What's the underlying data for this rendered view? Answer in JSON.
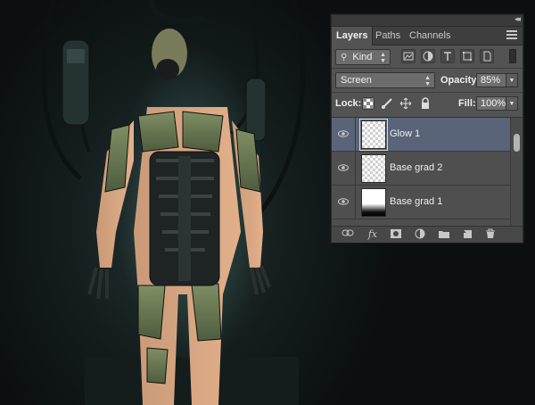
{
  "panel": {
    "tabs": [
      "Layers",
      "Paths",
      "Channels"
    ],
    "active_tab": "Layers",
    "filter": {
      "kind_label": "Kind"
    },
    "blend_mode": "Screen",
    "opacity_label": "Opacity:",
    "opacity_value": "85%",
    "lock_label": "Lock:",
    "fill_label": "Fill:",
    "fill_value": "100%",
    "layers": [
      {
        "name": "Glow 1",
        "selected": true,
        "thumb": "transparent"
      },
      {
        "name": "Base grad 2",
        "selected": false,
        "thumb": "transparent"
      },
      {
        "name": "Base grad 1",
        "selected": false,
        "thumb": "gradient"
      }
    ],
    "footer_icons": [
      "link-icon",
      "fx-icon",
      "mask-icon",
      "adjustment-icon",
      "folder-icon",
      "new-layer-icon",
      "trash-icon"
    ],
    "footer_fx_label": "fx"
  },
  "colors": {
    "panel_bg": "#535353",
    "selected_layer": "#5a6478",
    "canvas_bg": "#141c1c"
  }
}
